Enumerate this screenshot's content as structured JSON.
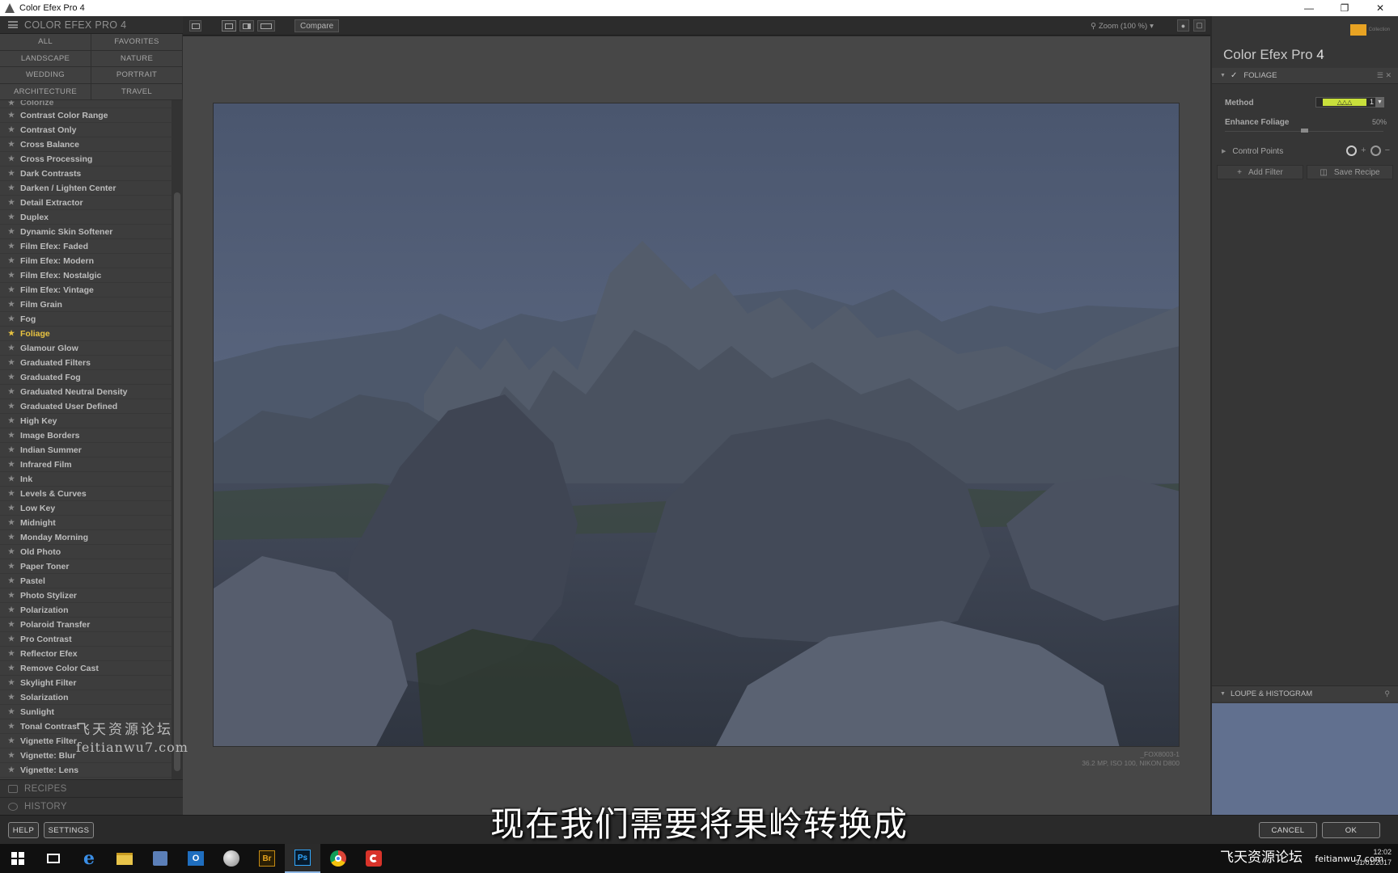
{
  "window": {
    "title": "Color Efex Pro 4",
    "controls": [
      "minimize-icon",
      "restore-icon",
      "close-icon"
    ]
  },
  "left_panel": {
    "header": "COLOR EFEX PRO 4",
    "categories": [
      "ALL",
      "FAVORITES",
      "LANDSCAPE",
      "NATURE",
      "WEDDING",
      "PORTRAIT",
      "ARCHITECTURE",
      "TRAVEL"
    ],
    "partial_item": "Colorize",
    "filters": [
      "Contrast Color Range",
      "Contrast Only",
      "Cross Balance",
      "Cross Processing",
      "Dark Contrasts",
      "Darken / Lighten Center",
      "Detail Extractor",
      "Duplex",
      "Dynamic Skin Softener",
      "Film Efex: Faded",
      "Film Efex: Modern",
      "Film Efex: Nostalgic",
      "Film Efex: Vintage",
      "Film Grain",
      "Fog",
      "Foliage",
      "Glamour Glow",
      "Graduated Filters",
      "Graduated Fog",
      "Graduated Neutral Density",
      "Graduated User Defined",
      "High Key",
      "Image Borders",
      "Indian Summer",
      "Infrared Film",
      "Ink",
      "Levels & Curves",
      "Low Key",
      "Midnight",
      "Monday Morning",
      "Old Photo",
      "Paper Toner",
      "Pastel",
      "Photo Stylizer",
      "Polarization",
      "Polaroid Transfer",
      "Pro Contrast",
      "Reflector Efex",
      "Remove Color Cast",
      "Skylight Filter",
      "Solarization",
      "Sunlight",
      "Tonal Contrast",
      "Vignette Filter",
      "Vignette: Blur",
      "Vignette: Lens"
    ],
    "selected_filter": "Foliage",
    "recipes_label": "RECIPES",
    "history_label": "HISTORY"
  },
  "toolbar": {
    "compare_label": "Compare",
    "zoom_label": "Zoom (100 %)"
  },
  "image": {
    "filename": "_FOX8003-1",
    "info": "36.2 MP, ISO 100, NIKON D800"
  },
  "right_panel": {
    "brand_title": "Color Efex Pro",
    "brand_version": "4",
    "collection_label": "Collection",
    "filter_name": "FOLIAGE",
    "method_label": "Method",
    "method_value": "1",
    "enhance_label": "Enhance Foliage",
    "enhance_value": "50%",
    "enhance_fraction": 0.5,
    "control_points_label": "Control Points",
    "add_filter_label": "Add Filter",
    "save_recipe_label": "Save Recipe",
    "loupe_label": "LOUPE & HISTOGRAM",
    "accent_color": "#c9e03c"
  },
  "bottom": {
    "help_label": "HELP",
    "settings_label": "SETTINGS",
    "cancel_label": "CANCEL",
    "ok_label": "OK"
  },
  "subtitle": "现在我们需要将果岭转换成",
  "watermark": {
    "side_cn": "飞天资源论坛",
    "side_url": "feitianwu7.com",
    "bottom_cn": "飞天资源论坛",
    "bottom_url": "feitianwu7.com"
  },
  "taskbar": {
    "apps": [
      "windows-start-icon",
      "task-view-icon",
      "edge-icon",
      "file-explorer-icon",
      "store-icon",
      "outlook-icon",
      "media-icon",
      "bridge-icon",
      "photoshop-icon",
      "chrome-icon",
      "camtasia-icon"
    ],
    "time": "12:02",
    "date": "31/01/2017"
  }
}
